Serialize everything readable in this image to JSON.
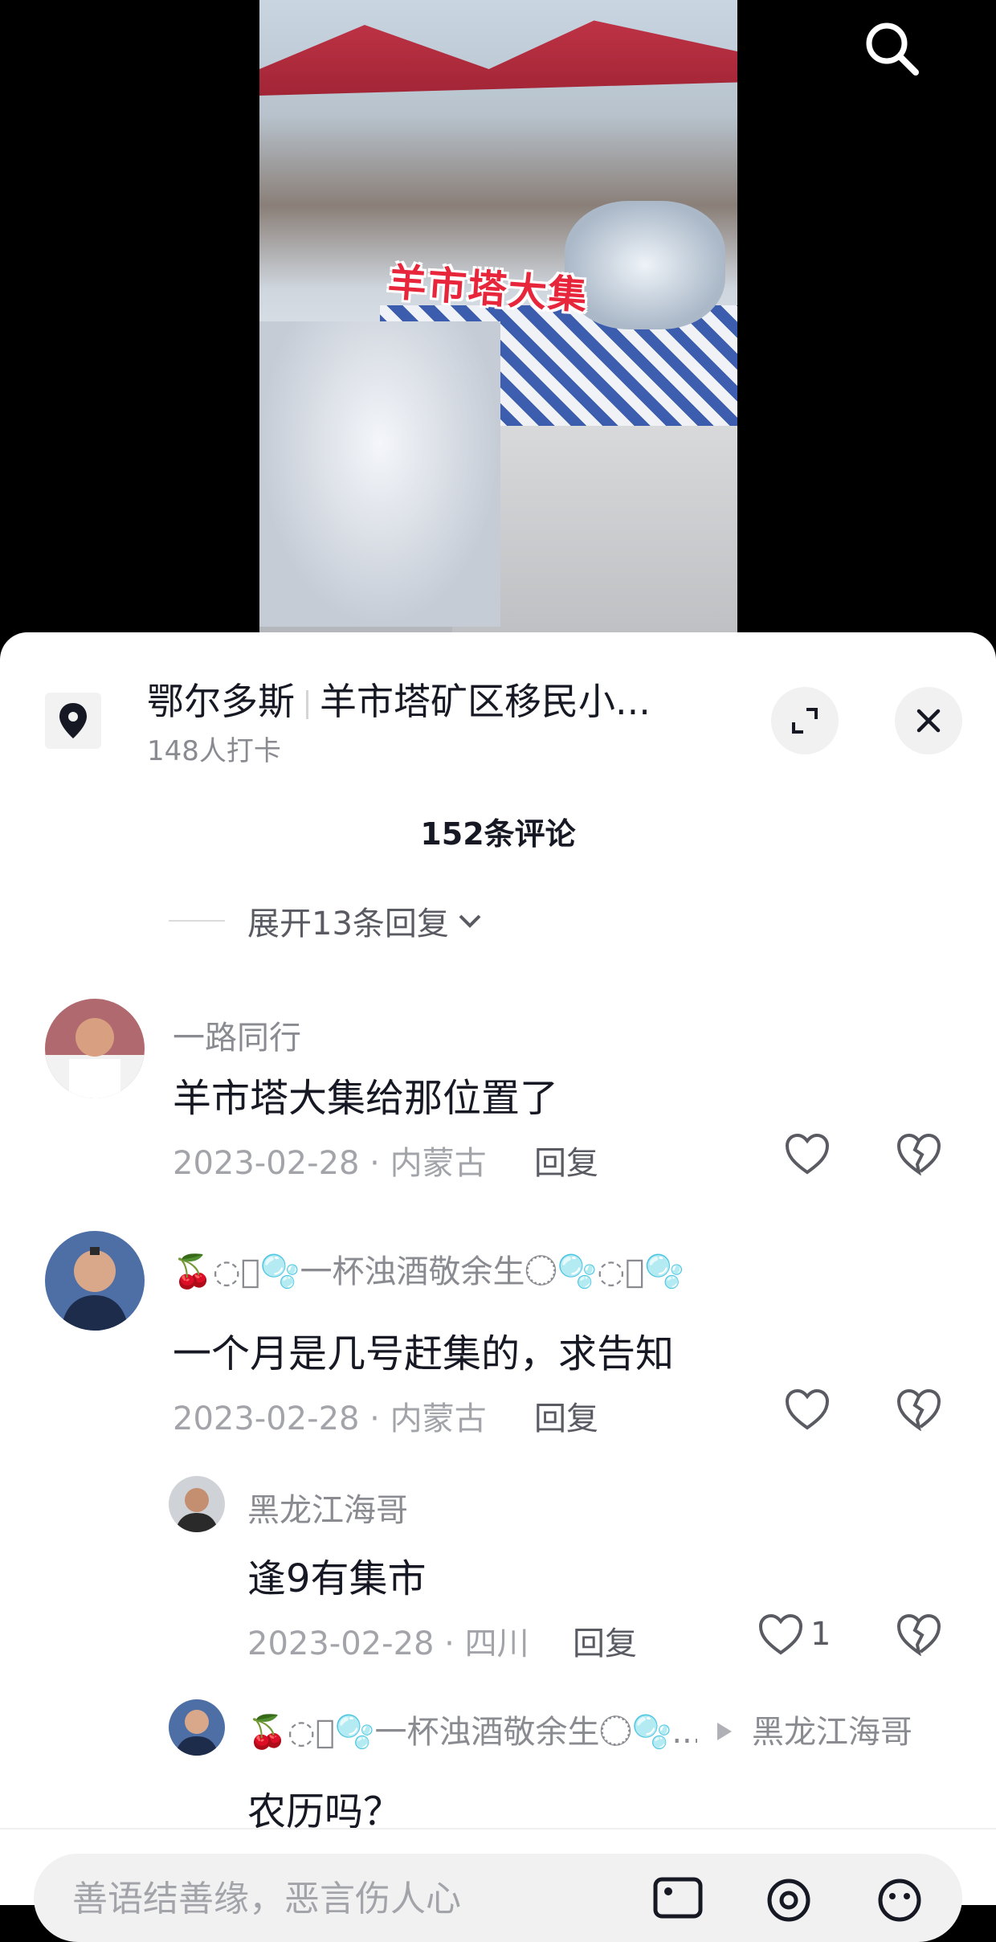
{
  "video": {
    "caption": "羊市塔大集"
  },
  "location": {
    "city": "鄂尔多斯",
    "place": "羊市塔矿区移民小...",
    "checkins": "148人打卡"
  },
  "comments_header": {
    "count": "152条评论",
    "expand_replies": "展开13条回复"
  },
  "comments": [
    {
      "user": "一路同行",
      "text": "羊市塔大集给那位置了",
      "meta": "2023-02-28 · 内蒙古",
      "reply": "回复"
    },
    {
      "user": "🍒◌⃝🫧一杯浊酒敬余生◌⃝🫧◌⃝🫧",
      "text": "一个月是几号赶集的，求告知",
      "meta": "2023-02-28 · 内蒙古",
      "reply": "回复"
    }
  ],
  "replies": [
    {
      "user": "黑龙江海哥",
      "text": "逢9有集市",
      "meta": "2023-02-28 · 四川",
      "reply": "回复",
      "likes": "1"
    },
    {
      "user": "🍒◌⃝🫧一杯浊酒敬余生◌⃝🫧...",
      "reply_to": "黑龙江海哥",
      "text": "农历吗？"
    }
  ],
  "input": {
    "placeholder": "善语结善缘，恶言伤人心"
  },
  "icons": [
    "search-icon",
    "location-pin-icon",
    "expand-icon",
    "close-icon",
    "chevron-down-icon",
    "heart-icon",
    "broken-heart-icon",
    "image-icon",
    "at-icon",
    "emoji-icon"
  ]
}
